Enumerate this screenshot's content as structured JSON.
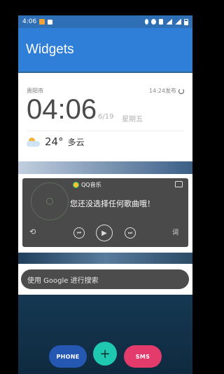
{
  "status_bar": {
    "time": "4:06"
  },
  "app_bar": {
    "title": "Widgets"
  },
  "clock_widget": {
    "city": "贵阳市",
    "published": "14:24发布",
    "time": "04:06",
    "date": "6/19",
    "weekday": "星期五",
    "temperature": "24°",
    "condition": "多云"
  },
  "music_widget": {
    "brand": "QQ音乐",
    "message": "您还没选择任何歌曲哦！",
    "loop_glyph": "⟲",
    "prev_glyph": "⏮",
    "play_glyph": "▶",
    "next_glyph": "⏭",
    "lyric_label": "词"
  },
  "search": {
    "placeholder": "使用 Google 进行搜索"
  },
  "bottom_buttons": {
    "phone": "PHONE",
    "plus": "+",
    "sms": "SMS"
  },
  "colors": {
    "app_bar": "#2f7ed8",
    "phone_button": "#2458b3",
    "plus_button": "#1fc9b1",
    "sms_button": "#e33c6c"
  }
}
